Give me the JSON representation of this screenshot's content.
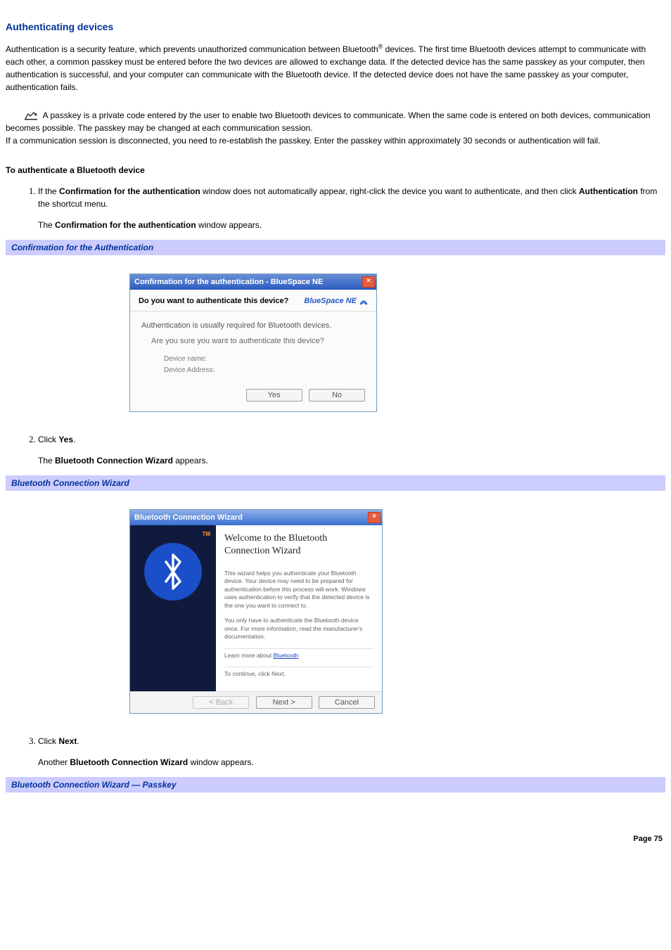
{
  "heading": "Authenticating devices",
  "intro_before_sup": "Authentication is a security feature, which prevents unauthorized communication between Bluetooth",
  "intro_sup": "®",
  "intro_after_sup": " devices. The first time Bluetooth devices attempt to communicate with each other, a common passkey must be entered before the two devices are allowed to exchange data. If the detected device has the same passkey as your computer, then authentication is successful, and your computer can communicate with the Bluetooth device. If the detected device does not have the same passkey as your computer, authentication fails.",
  "note_p1": "A passkey is a private code entered by the user to enable two Bluetooth devices to communicate. When the same code is entered on both devices, communication becomes possible. The passkey may be changed at each communication session.",
  "note_p2": "If a communication session is disconnected, you need to re-establish the passkey. Enter the passkey within approximately 30 seconds or authentication will fail.",
  "subheading": "To authenticate a Bluetooth device",
  "step1_a": "If the ",
  "step1_b": "Confirmation for the authentication",
  "step1_c": " window does not automatically appear, right-click the device you want to authenticate, and then click ",
  "step1_d": "Authentication",
  "step1_e": " from the shortcut menu.",
  "step1_follow_a": "The ",
  "step1_follow_b": "Confirmation for the authentication",
  "step1_follow_c": " window appears.",
  "caption1": "Confirmation for the Authentication",
  "dlg1": {
    "title": "Confirmation for the authentication - BlueSpace NE",
    "question": "Do you want to authenticate this device?",
    "logo": "BlueSpace NE",
    "line1": "Authentication is usually required for Bluetooth devices.",
    "line2": "Are you sure you want to authenticate this device?",
    "kv1": "Device name:",
    "kv2": "Device Address:",
    "yes": "Yes",
    "no": "No"
  },
  "step2_a": "Click ",
  "step2_b": "Yes",
  "step2_c": ".",
  "step2_follow_a": "The ",
  "step2_follow_b": "Bluetooth Connection Wizard",
  "step2_follow_c": " appears.",
  "caption2": "Bluetooth Connection Wizard",
  "dlg2": {
    "title": "Bluetooth Connection Wizard",
    "tm": "TM",
    "wtitle": "Welcome to the Bluetooth Connection Wizard",
    "p1": "This wizard helps you authenticate your Bluetooth device. Your device may need to be prepared for authentication before this process will work. Windows uses authentication to verify that the detected device is the one you want to connect to.",
    "p2": "You only have to authenticate the Bluetooth device once. For more information, read the manufacturer's documentation.",
    "p3a": "Learn more about ",
    "p3link": "Bluetooth",
    "p4": "To continue, click Next.",
    "back": "< Back",
    "next": "Next >",
    "cancel": "Cancel"
  },
  "step3_a": "Click ",
  "step3_b": "Next",
  "step3_c": ".",
  "step3_follow_a": "Another ",
  "step3_follow_b": "Bluetooth Connection Wizard",
  "step3_follow_c": " window appears.",
  "caption3": "Bluetooth Connection Wizard — Passkey",
  "footer": "Page 75"
}
